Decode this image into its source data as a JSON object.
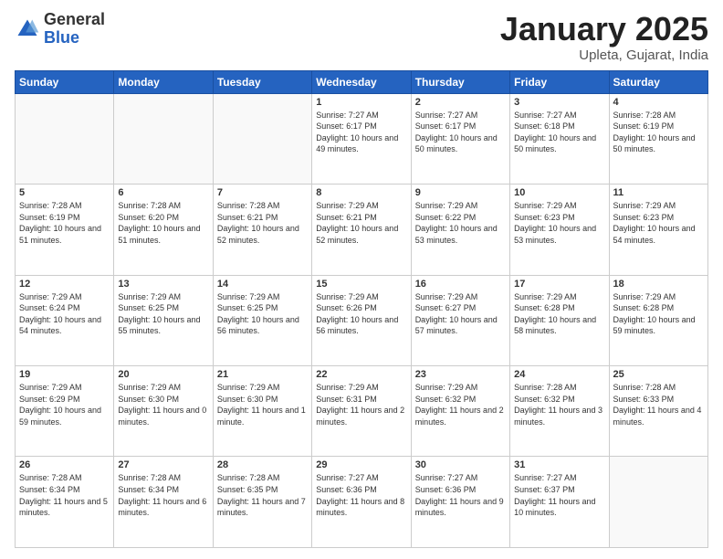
{
  "logo": {
    "general": "General",
    "blue": "Blue"
  },
  "title": {
    "month": "January 2025",
    "location": "Upleta, Gujarat, India"
  },
  "days_header": [
    "Sunday",
    "Monday",
    "Tuesday",
    "Wednesday",
    "Thursday",
    "Friday",
    "Saturday"
  ],
  "weeks": [
    [
      {
        "day": "",
        "info": ""
      },
      {
        "day": "",
        "info": ""
      },
      {
        "day": "",
        "info": ""
      },
      {
        "day": "1",
        "info": "Sunrise: 7:27 AM\nSunset: 6:17 PM\nDaylight: 10 hours\nand 49 minutes."
      },
      {
        "day": "2",
        "info": "Sunrise: 7:27 AM\nSunset: 6:17 PM\nDaylight: 10 hours\nand 50 minutes."
      },
      {
        "day": "3",
        "info": "Sunrise: 7:27 AM\nSunset: 6:18 PM\nDaylight: 10 hours\nand 50 minutes."
      },
      {
        "day": "4",
        "info": "Sunrise: 7:28 AM\nSunset: 6:19 PM\nDaylight: 10 hours\nand 50 minutes."
      }
    ],
    [
      {
        "day": "5",
        "info": "Sunrise: 7:28 AM\nSunset: 6:19 PM\nDaylight: 10 hours\nand 51 minutes."
      },
      {
        "day": "6",
        "info": "Sunrise: 7:28 AM\nSunset: 6:20 PM\nDaylight: 10 hours\nand 51 minutes."
      },
      {
        "day": "7",
        "info": "Sunrise: 7:28 AM\nSunset: 6:21 PM\nDaylight: 10 hours\nand 52 minutes."
      },
      {
        "day": "8",
        "info": "Sunrise: 7:29 AM\nSunset: 6:21 PM\nDaylight: 10 hours\nand 52 minutes."
      },
      {
        "day": "9",
        "info": "Sunrise: 7:29 AM\nSunset: 6:22 PM\nDaylight: 10 hours\nand 53 minutes."
      },
      {
        "day": "10",
        "info": "Sunrise: 7:29 AM\nSunset: 6:23 PM\nDaylight: 10 hours\nand 53 minutes."
      },
      {
        "day": "11",
        "info": "Sunrise: 7:29 AM\nSunset: 6:23 PM\nDaylight: 10 hours\nand 54 minutes."
      }
    ],
    [
      {
        "day": "12",
        "info": "Sunrise: 7:29 AM\nSunset: 6:24 PM\nDaylight: 10 hours\nand 54 minutes."
      },
      {
        "day": "13",
        "info": "Sunrise: 7:29 AM\nSunset: 6:25 PM\nDaylight: 10 hours\nand 55 minutes."
      },
      {
        "day": "14",
        "info": "Sunrise: 7:29 AM\nSunset: 6:25 PM\nDaylight: 10 hours\nand 56 minutes."
      },
      {
        "day": "15",
        "info": "Sunrise: 7:29 AM\nSunset: 6:26 PM\nDaylight: 10 hours\nand 56 minutes."
      },
      {
        "day": "16",
        "info": "Sunrise: 7:29 AM\nSunset: 6:27 PM\nDaylight: 10 hours\nand 57 minutes."
      },
      {
        "day": "17",
        "info": "Sunrise: 7:29 AM\nSunset: 6:28 PM\nDaylight: 10 hours\nand 58 minutes."
      },
      {
        "day": "18",
        "info": "Sunrise: 7:29 AM\nSunset: 6:28 PM\nDaylight: 10 hours\nand 59 minutes."
      }
    ],
    [
      {
        "day": "19",
        "info": "Sunrise: 7:29 AM\nSunset: 6:29 PM\nDaylight: 10 hours\nand 59 minutes."
      },
      {
        "day": "20",
        "info": "Sunrise: 7:29 AM\nSunset: 6:30 PM\nDaylight: 11 hours\nand 0 minutes."
      },
      {
        "day": "21",
        "info": "Sunrise: 7:29 AM\nSunset: 6:30 PM\nDaylight: 11 hours\nand 1 minute."
      },
      {
        "day": "22",
        "info": "Sunrise: 7:29 AM\nSunset: 6:31 PM\nDaylight: 11 hours\nand 2 minutes."
      },
      {
        "day": "23",
        "info": "Sunrise: 7:29 AM\nSunset: 6:32 PM\nDaylight: 11 hours\nand 2 minutes."
      },
      {
        "day": "24",
        "info": "Sunrise: 7:28 AM\nSunset: 6:32 PM\nDaylight: 11 hours\nand 3 minutes."
      },
      {
        "day": "25",
        "info": "Sunrise: 7:28 AM\nSunset: 6:33 PM\nDaylight: 11 hours\nand 4 minutes."
      }
    ],
    [
      {
        "day": "26",
        "info": "Sunrise: 7:28 AM\nSunset: 6:34 PM\nDaylight: 11 hours\nand 5 minutes."
      },
      {
        "day": "27",
        "info": "Sunrise: 7:28 AM\nSunset: 6:34 PM\nDaylight: 11 hours\nand 6 minutes."
      },
      {
        "day": "28",
        "info": "Sunrise: 7:28 AM\nSunset: 6:35 PM\nDaylight: 11 hours\nand 7 minutes."
      },
      {
        "day": "29",
        "info": "Sunrise: 7:27 AM\nSunset: 6:36 PM\nDaylight: 11 hours\nand 8 minutes."
      },
      {
        "day": "30",
        "info": "Sunrise: 7:27 AM\nSunset: 6:36 PM\nDaylight: 11 hours\nand 9 minutes."
      },
      {
        "day": "31",
        "info": "Sunrise: 7:27 AM\nSunset: 6:37 PM\nDaylight: 11 hours\nand 10 minutes."
      },
      {
        "day": "",
        "info": ""
      }
    ]
  ]
}
